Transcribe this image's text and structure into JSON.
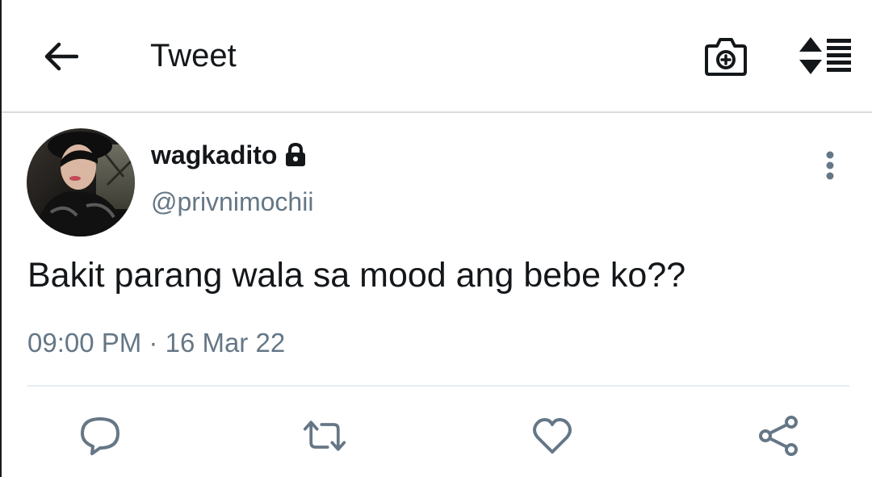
{
  "header": {
    "title": "Tweet",
    "icons": {
      "back": "back-arrow-icon",
      "camera": "camera-add-icon",
      "sort": "sort-order-icon"
    }
  },
  "tweet": {
    "author": {
      "display_name": "wagkadito",
      "handle": "@privnimochii",
      "protected": true
    },
    "text": "Bakit parang wala sa mood ang bebe ko??",
    "time": "09:00 PM",
    "separator": "·",
    "date": "16 Mar 22"
  },
  "actions": [
    "reply-icon",
    "retweet-icon",
    "like-icon",
    "share-icon"
  ],
  "colors": {
    "text_primary": "#14171a",
    "text_secondary": "#657786",
    "icon": "#657786",
    "divider": "#e6ecf0"
  }
}
